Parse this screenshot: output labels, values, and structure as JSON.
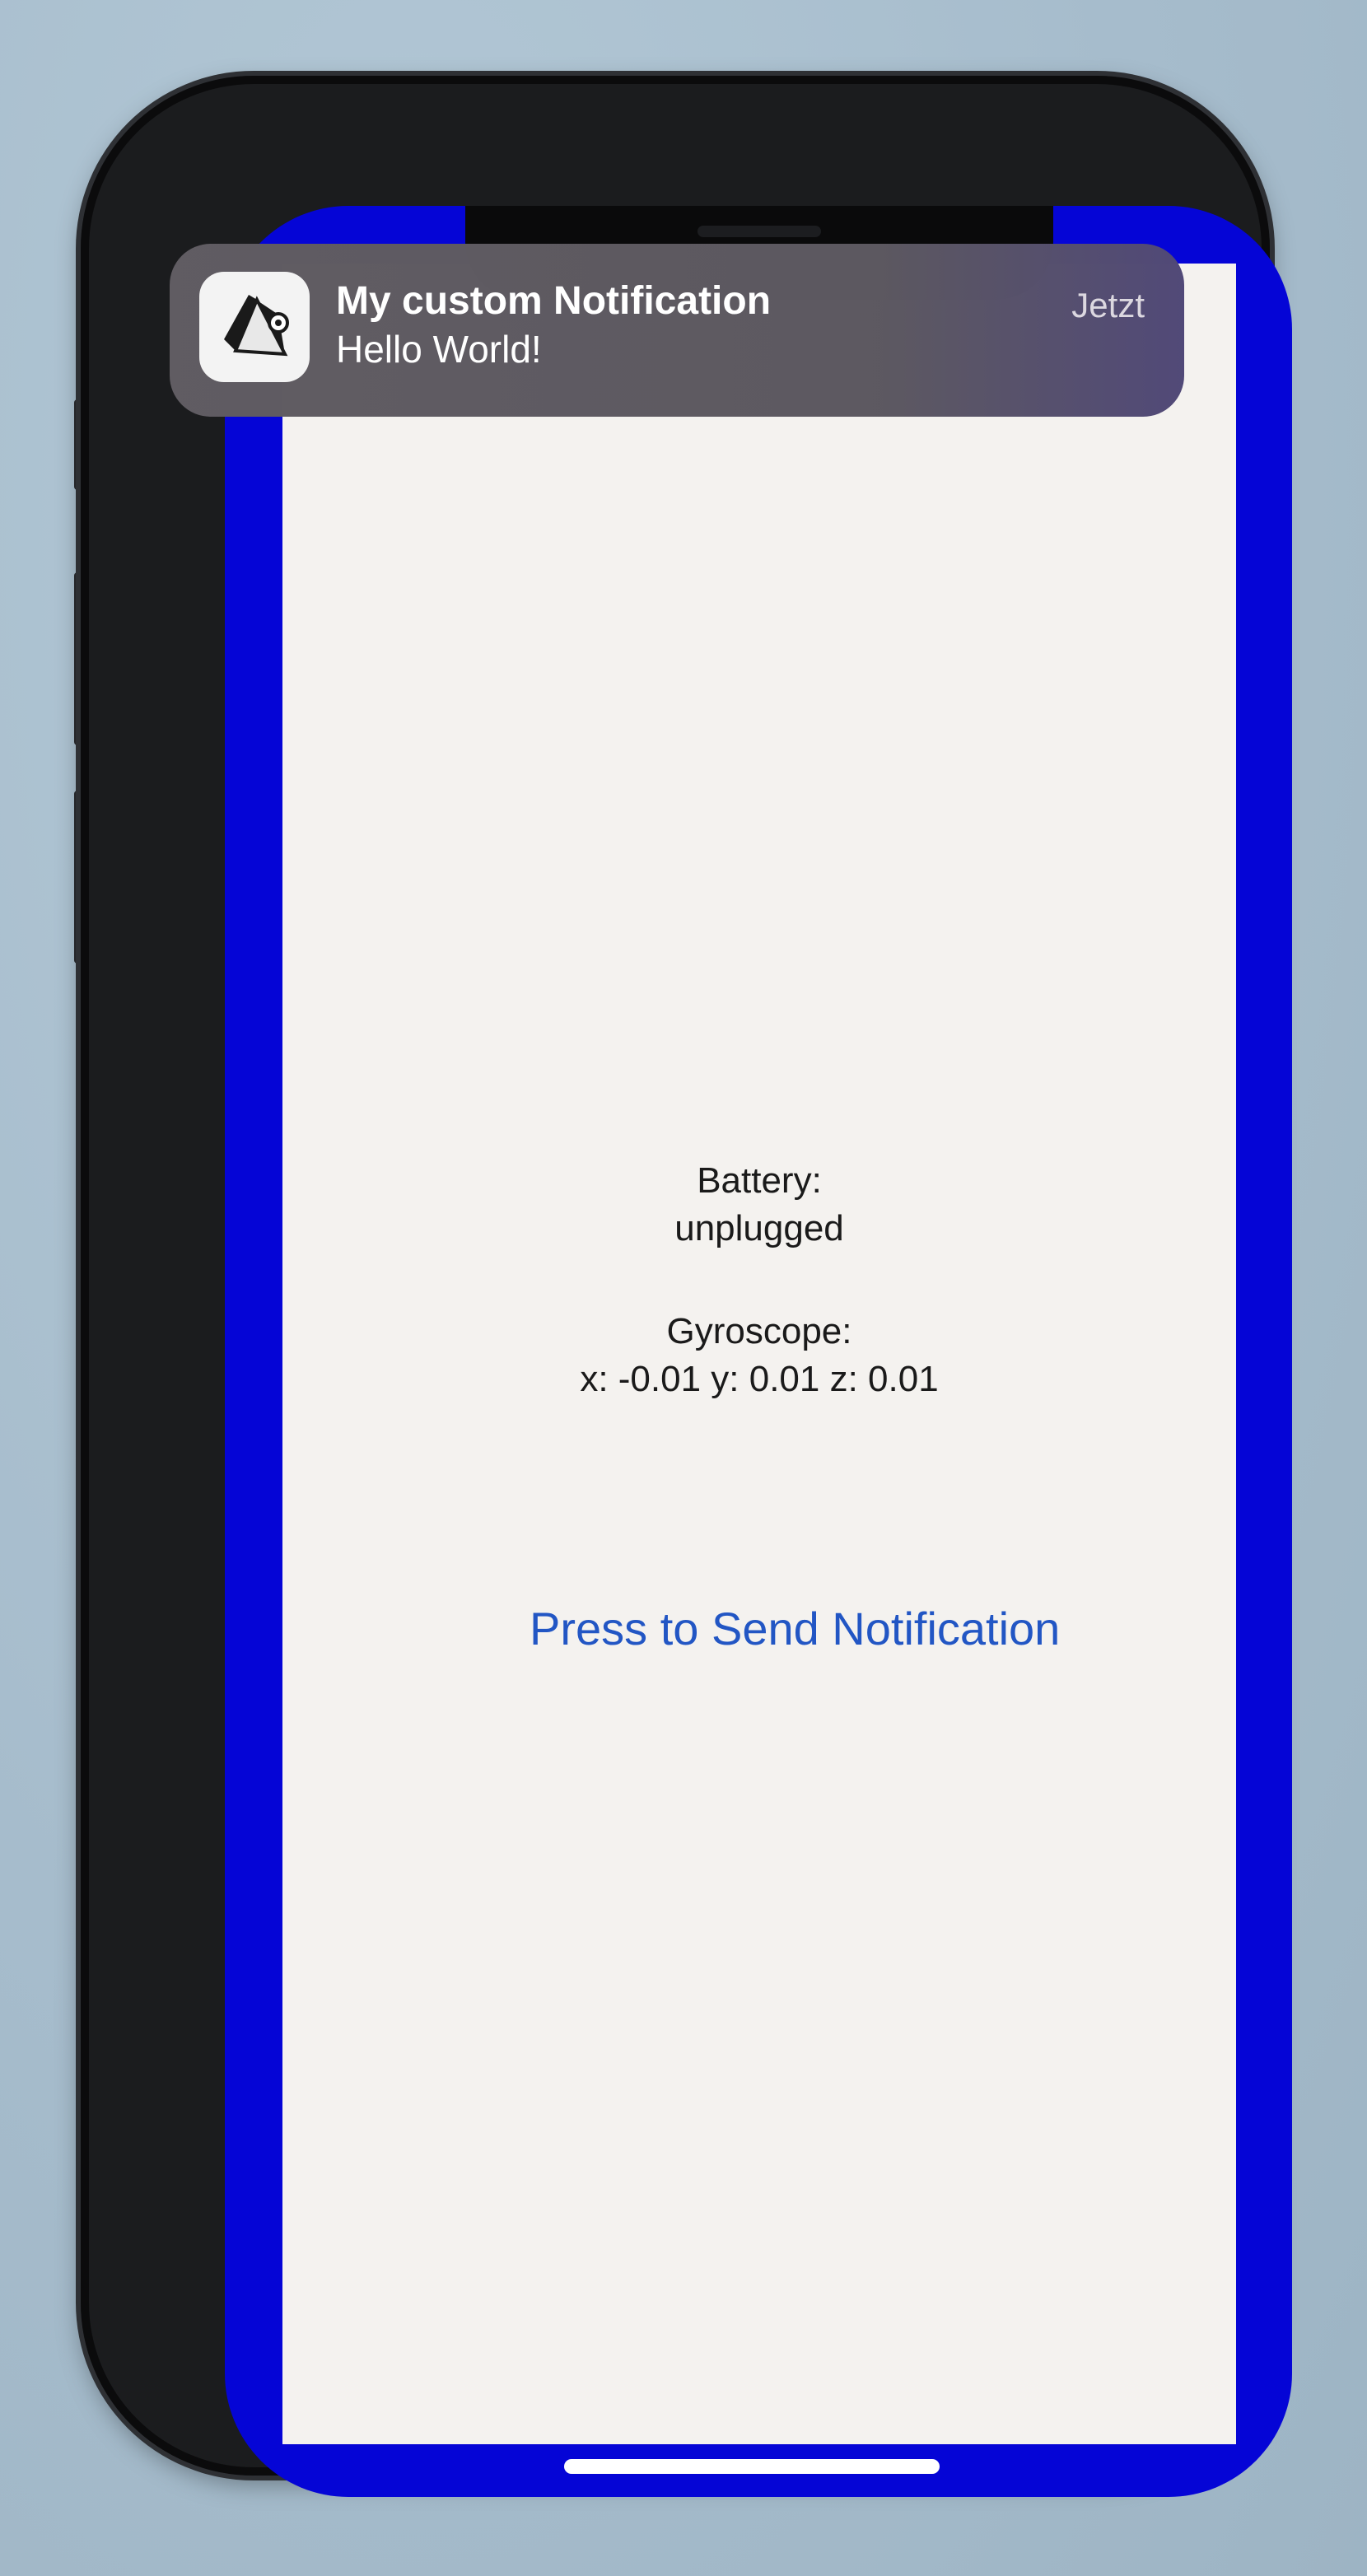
{
  "notification": {
    "app_icon": "app-logo-icon",
    "title": "My custom Notification",
    "body": "Hello World!",
    "time": "Jetzt"
  },
  "battery": {
    "label": "Battery:",
    "value": "unplugged"
  },
  "gyroscope": {
    "label": "Gyroscope:",
    "value": "x: -0.01 y: 0.01 z: 0.01"
  },
  "send_button": {
    "label": "Press to Send Notification"
  },
  "colors": {
    "screen_border": "#0505d6",
    "app_background": "#f4f2ef",
    "button_text": "#2256c4",
    "banner_background": "#5e5a62"
  }
}
